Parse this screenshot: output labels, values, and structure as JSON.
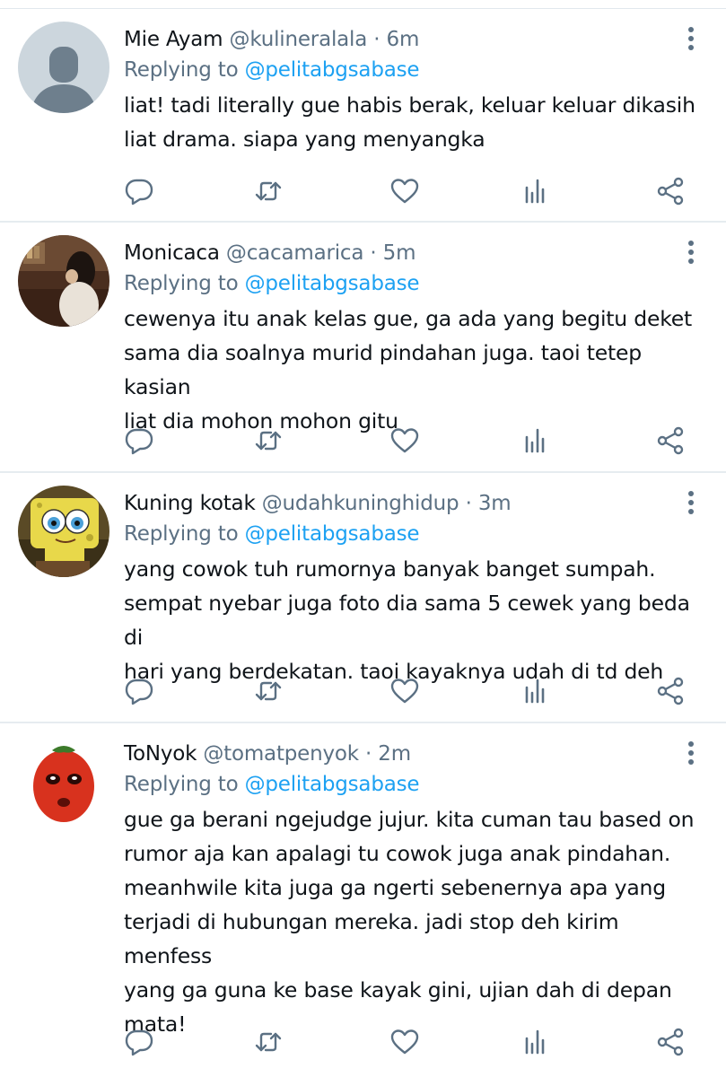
{
  "reply_label": "Replying to",
  "tweets": [
    {
      "name": "Mie Ayam",
      "handle": "@kulineralala",
      "sep": "·",
      "time": "6m",
      "replying_to": "@pelitabgsabase",
      "text": "liat! tadi literally gue habis berak, keluar keluar dikasih\nliat drama. siapa yang menyangka",
      "avatar": "default-avatar"
    },
    {
      "name": "Monicaca",
      "handle": "@cacamarica",
      "sep": "·",
      "time": "5m",
      "replying_to": "@pelitabgsabase",
      "text": "cewenya itu anak kelas gue, ga ada yang begitu deket\nsama dia soalnya murid pindahan juga. taoi tetep kasian\nliat dia mohon mohon gitu",
      "avatar": "photo-avatar"
    },
    {
      "name": "Kuning kotak",
      "handle": "@udahkuninghidup",
      "sep": "·",
      "time": "3m",
      "replying_to": "@pelitabgsabase",
      "text": "yang cowok tuh rumornya banyak banget sumpah.\nsempat nyebar juga foto dia sama 5 cewek yang beda di\nhari yang berdekatan. taoi kayaknya udah di td deh",
      "avatar": "sponge-avatar"
    },
    {
      "name": "ToNyok",
      "handle": "@tomatpenyok",
      "sep": "·",
      "time": "2m",
      "replying_to": "@pelitabgsabase",
      "text": "gue ga berani ngejudge jujur. kita cuman tau based on\nrumor aja kan apalagi tu cowok juga anak pindahan.\nmeanhwile kita juga ga ngerti sebenernya apa yang\nterjadi di hubungan mereka. jadi stop deh kirim menfess\nyang ga guna ke base kayak gini, ujian dah di depan\nmata!",
      "avatar": "tomato-avatar"
    }
  ],
  "icons": [
    "reply-icon",
    "retweet-icon",
    "like-icon",
    "analytics-icon",
    "share-icon",
    "more-options-icon"
  ],
  "colors": {
    "link": "#1da1f2",
    "muted": "#5b7083",
    "text": "#0f1419",
    "divider": "#e6ecf0"
  }
}
